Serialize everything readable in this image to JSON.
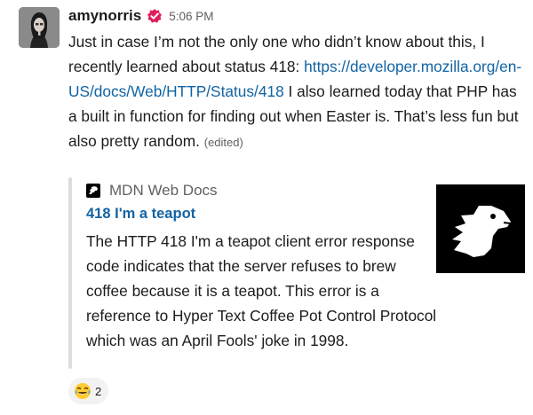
{
  "message": {
    "sender": "amynorris",
    "avatar_icon": "user-avatar-photo",
    "badge_icon": "verified-badge-icon",
    "timestamp": "5:06 PM",
    "text_before_link": "Just in case I’m not the only one who didn’t know about this, I recently learned about status 418: ",
    "link_text": "https://developer.mozilla.org/en-US/docs/Web/HTTP/Status/418",
    "text_after_link": " I also learned today that PHP has a built in function for finding out when Easter is. That’s less fun but also pretty random.",
    "edited_label": "(edited)"
  },
  "attachment": {
    "service_icon": "mdn-dino-icon",
    "service_name": "MDN Web Docs",
    "title": "418 I'm a teapot",
    "description": "The HTTP 418 I'm a teapot client error response code indicates that the server refuses to brew coffee because it is a teapot. This error is a reference to Hyper Text Coffee Pot Control Protocol which was an April Fools' joke in 1998.",
    "thumbnail_icon": "mdn-logo-thumbnail"
  },
  "reactions": [
    {
      "emoji": "joy-emoji-icon",
      "count": "2"
    }
  ],
  "colors": {
    "link": "#1264a3",
    "badge": "#e01e5a",
    "muted": "#616061",
    "attachment_bar": "#dddddd"
  }
}
